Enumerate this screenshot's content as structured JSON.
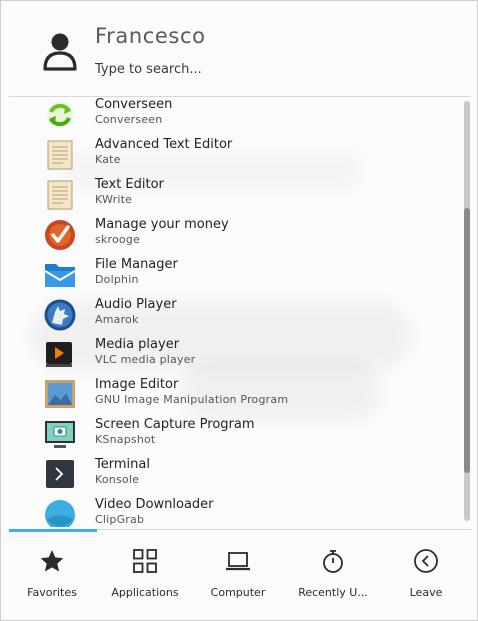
{
  "user": {
    "name": "Francesco"
  },
  "search": {
    "placeholder": "Type to search..."
  },
  "apps": [
    {
      "name": "Converseen",
      "generic": "Converseen",
      "icon": "converseen-icon"
    },
    {
      "name": "Advanced Text Editor",
      "generic": "Kate",
      "icon": "kate-icon"
    },
    {
      "name": "Text Editor",
      "generic": "KWrite",
      "icon": "kwrite-icon"
    },
    {
      "name": "Manage your money",
      "generic": "skrooge",
      "icon": "skrooge-icon"
    },
    {
      "name": "File Manager",
      "generic": "Dolphin",
      "icon": "dolphin-icon"
    },
    {
      "name": "Audio Player",
      "generic": "Amarok",
      "icon": "amarok-icon"
    },
    {
      "name": "Media player",
      "generic": "VLC media player",
      "icon": "vlc-icon"
    },
    {
      "name": "Image Editor",
      "generic": "GNU Image Manipulation Program",
      "icon": "gimp-icon"
    },
    {
      "name": "Screen Capture Program",
      "generic": "KSnapshot",
      "icon": "ksnapshot-icon"
    },
    {
      "name": "Terminal",
      "generic": "Konsole",
      "icon": "konsole-icon"
    },
    {
      "name": "Video Downloader",
      "generic": "ClipGrab",
      "icon": "clipgrab-icon"
    }
  ],
  "tabs": [
    {
      "label": "Favorites",
      "icon": "star-icon",
      "active": true
    },
    {
      "label": "Applications",
      "icon": "grid-icon"
    },
    {
      "label": "Computer",
      "icon": "laptop-icon"
    },
    {
      "label": "Recently U...",
      "icon": "clock-icon"
    },
    {
      "label": "Leave",
      "icon": "back-circle-icon"
    }
  ],
  "colors": {
    "accent": "#3daee9",
    "background": "#fbfbfb"
  }
}
